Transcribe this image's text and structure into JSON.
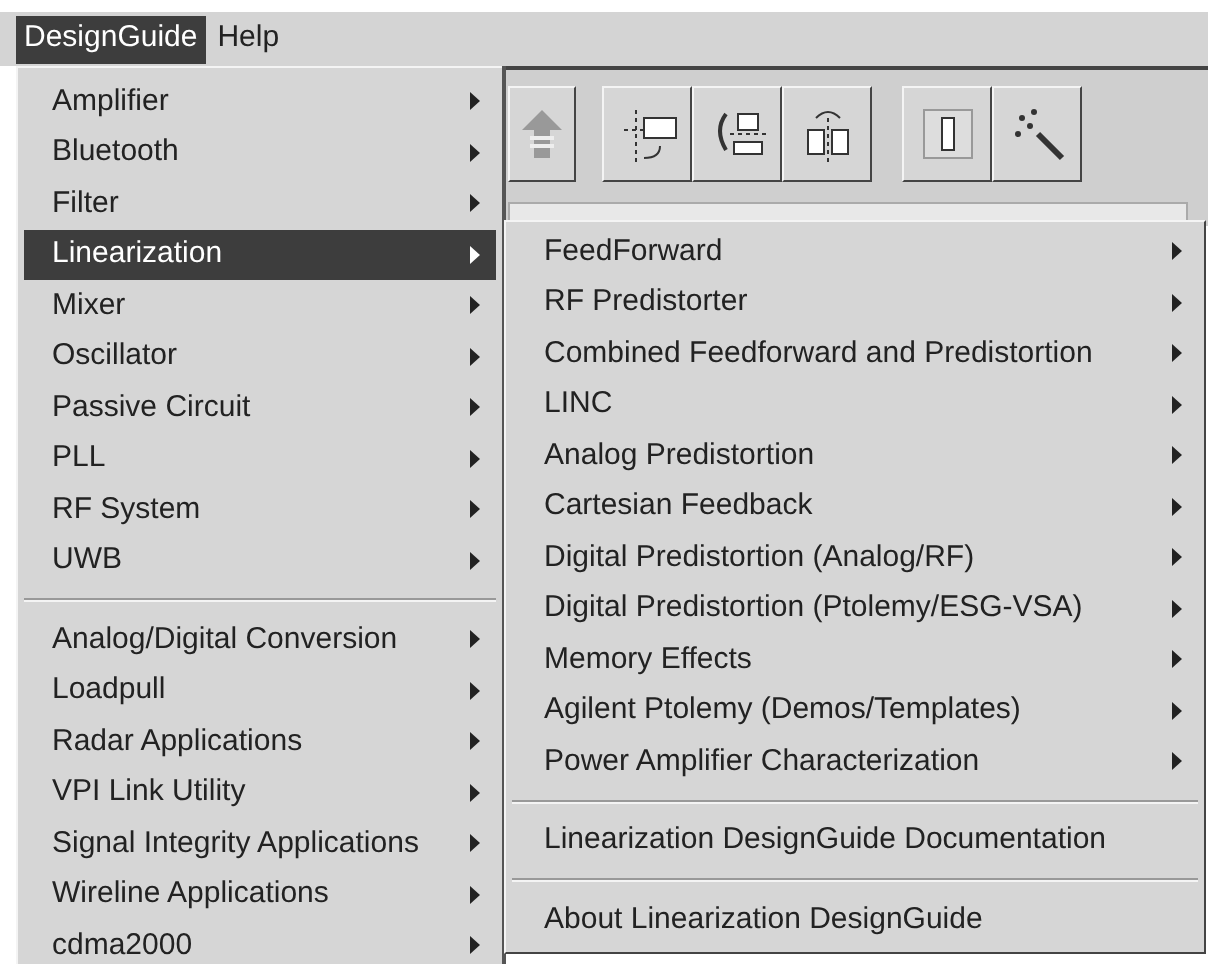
{
  "menubar": [
    {
      "label": "DesignGuide",
      "selected": true
    },
    {
      "label": "Help",
      "selected": false
    }
  ],
  "menu": {
    "sections": [
      [
        {
          "label": "Amplifier",
          "selected": false,
          "has_submenu": true
        },
        {
          "label": "Bluetooth",
          "selected": false,
          "has_submenu": true
        },
        {
          "label": "Filter",
          "selected": false,
          "has_submenu": true
        },
        {
          "label": "Linearization",
          "selected": true,
          "has_submenu": true
        },
        {
          "label": "Mixer",
          "selected": false,
          "has_submenu": true
        },
        {
          "label": "Oscillator",
          "selected": false,
          "has_submenu": true
        },
        {
          "label": "Passive Circuit",
          "selected": false,
          "has_submenu": true
        },
        {
          "label": "PLL",
          "selected": false,
          "has_submenu": true
        },
        {
          "label": "RF System",
          "selected": false,
          "has_submenu": true
        },
        {
          "label": "UWB",
          "selected": false,
          "has_submenu": true
        }
      ],
      [
        {
          "label": "Analog/Digital Conversion",
          "selected": false,
          "has_submenu": true
        },
        {
          "label": "Loadpull",
          "selected": false,
          "has_submenu": true
        },
        {
          "label": "Radar Applications",
          "selected": false,
          "has_submenu": true
        },
        {
          "label": "VPI Link Utility",
          "selected": false,
          "has_submenu": true
        },
        {
          "label": "Signal Integrity Applications",
          "selected": false,
          "has_submenu": true
        },
        {
          "label": "Wireline Applications",
          "selected": false,
          "has_submenu": true
        },
        {
          "label": "cdma2000",
          "selected": false,
          "has_submenu": true
        }
      ]
    ]
  },
  "submenu": {
    "sections": [
      [
        {
          "label": "FeedForward",
          "has_submenu": true
        },
        {
          "label": "RF Predistorter",
          "has_submenu": true
        },
        {
          "label": "Combined Feedforward and Predistortion",
          "has_submenu": true
        },
        {
          "label": "LINC",
          "has_submenu": true
        },
        {
          "label": "Analog Predistortion",
          "has_submenu": true
        },
        {
          "label": "Cartesian Feedback",
          "has_submenu": true
        },
        {
          "label": "Digital Predistortion (Analog/RF)",
          "has_submenu": true
        },
        {
          "label": "Digital Predistortion (Ptolemy/ESG-VSA)",
          "has_submenu": true
        },
        {
          "label": "Memory Effects",
          "has_submenu": true
        },
        {
          "label": "Agilent Ptolemy (Demos/Templates)",
          "has_submenu": true
        },
        {
          "label": "Power Amplifier Characterization",
          "has_submenu": true
        }
      ],
      [
        {
          "label": "Linearization DesignGuide Documentation",
          "has_submenu": false
        }
      ],
      [
        {
          "label": "About Linearization DesignGuide",
          "has_submenu": false
        }
      ]
    ]
  }
}
